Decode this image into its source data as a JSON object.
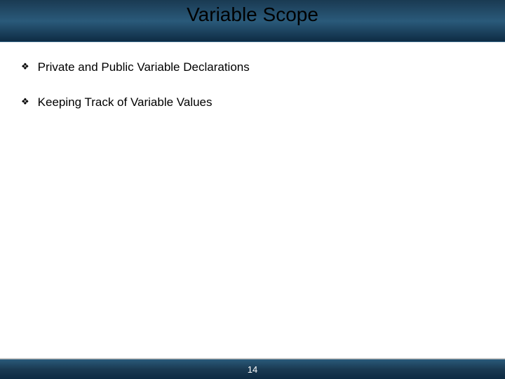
{
  "slide": {
    "title": "Variable Scope",
    "bullets": [
      "Private and Public Variable Declarations",
      "Keeping Track of Variable Values"
    ],
    "page_number": "14"
  }
}
